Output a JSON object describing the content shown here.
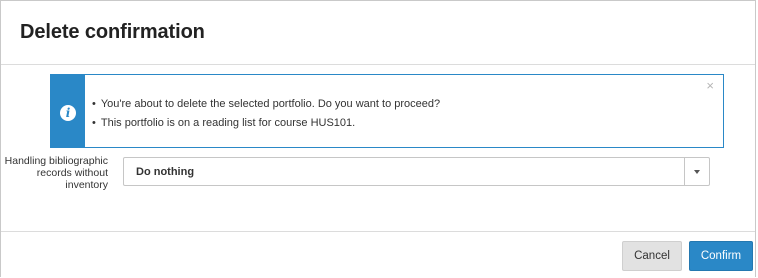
{
  "dialog": {
    "title": "Delete confirmation"
  },
  "alert": {
    "icon": "info-icon",
    "close_symbol": "×",
    "messages": [
      "You're about to delete the selected portfolio. Do you want to proceed?",
      "This portfolio is on a reading list for course HUS101."
    ]
  },
  "handling": {
    "label": "Handling bibliographic records without inventory",
    "selected": "Do nothing"
  },
  "footer": {
    "cancel_label": "Cancel",
    "confirm_label": "Confirm"
  },
  "colors": {
    "accent": "#2a88c7",
    "cancel_bg": "#e2e2e2"
  }
}
